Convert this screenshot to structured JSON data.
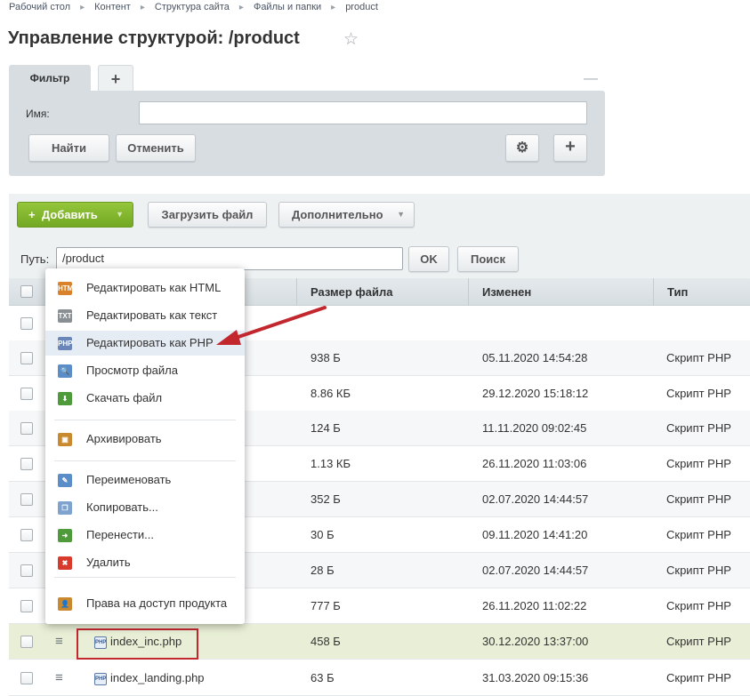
{
  "breadcrumb": [
    "Рабочий стол",
    "Контент",
    "Структура сайта",
    "Файлы и папки",
    "product"
  ],
  "page_title": "Управление структурой: /product",
  "filter": {
    "tab_label": "Фильтр",
    "add_tab_label": "+",
    "name_label": "Имя:",
    "name_value": "",
    "find_label": "Найти",
    "cancel_label": "Отменить"
  },
  "toolbar": {
    "add_label": "Добавить",
    "upload_label": "Загрузить файл",
    "more_label": "Дополнительно"
  },
  "pathbar": {
    "label": "Путь:",
    "value": "/product",
    "ok_label": "OK",
    "search_label": "Поиск"
  },
  "grid": {
    "columns": [
      "Размер файла",
      "Изменен",
      "Тип"
    ],
    "rows": [
      {
        "name": "",
        "size": "",
        "modified": "",
        "type": ""
      },
      {
        "name": "",
        "size": "938 Б",
        "modified": "05.11.2020 14:54:28",
        "type": "Скрипт PHP"
      },
      {
        "name": "",
        "size": "8.86 КБ",
        "modified": "29.12.2020 15:18:12",
        "type": "Скрипт PHP"
      },
      {
        "name": "",
        "size": "124 Б",
        "modified": "11.11.2020 09:02:45",
        "type": "Скрипт PHP"
      },
      {
        "name": "",
        "size": "1.13 КБ",
        "modified": "26.11.2020 11:03:06",
        "type": "Скрипт PHP"
      },
      {
        "name": "",
        "size": "352 Б",
        "modified": "02.07.2020 14:44:57",
        "type": "Скрипт PHP"
      },
      {
        "name": "",
        "size": "30 Б",
        "modified": "09.11.2020 14:41:20",
        "type": "Скрипт PHP"
      },
      {
        "name": "",
        "size": "28 Б",
        "modified": "02.07.2020 14:44:57",
        "type": "Скрипт PHP"
      },
      {
        "name": "",
        "size": "777 Б",
        "modified": "26.11.2020 11:02:22",
        "type": "Скрипт PHP"
      },
      {
        "name": "index_inc.php",
        "size": "458 Б",
        "modified": "30.12.2020 13:37:00",
        "type": "Скрипт PHP"
      },
      {
        "name": "index_landing.php",
        "size": "63 Б",
        "modified": "31.03.2020 09:15:36",
        "type": "Скрипт PHP"
      }
    ]
  },
  "context_menu": {
    "items": [
      {
        "label": "Редактировать как HTML",
        "icon": "HTM",
        "color": "#d9822b"
      },
      {
        "label": "Редактировать как текст",
        "icon": "TXT",
        "color": "#8a8f94"
      },
      {
        "label": "Редактировать как PHP",
        "icon": "PHP",
        "color": "#6a86b8"
      },
      {
        "label": "Просмотр файла",
        "icon": "magnifier-icon",
        "color": "#5b8ec9"
      },
      {
        "label": "Скачать файл",
        "icon": "download-icon",
        "color": "#4f9a3a"
      },
      {
        "label": "Архивировать",
        "icon": "archive-icon",
        "color": "#c9892e"
      },
      {
        "label": "Переименовать",
        "icon": "rename-icon",
        "color": "#5b8ec9"
      },
      {
        "label": "Копировать...",
        "icon": "copy-icon",
        "color": "#7fa3cf"
      },
      {
        "label": "Перенести...",
        "icon": "move-icon",
        "color": "#4f9a3a"
      },
      {
        "label": "Удалить",
        "icon": "delete-icon",
        "color": "#d83a2b"
      },
      {
        "label": "Права на доступ продукта",
        "icon": "user-lock-icon",
        "color": "#c9892e"
      }
    ]
  }
}
